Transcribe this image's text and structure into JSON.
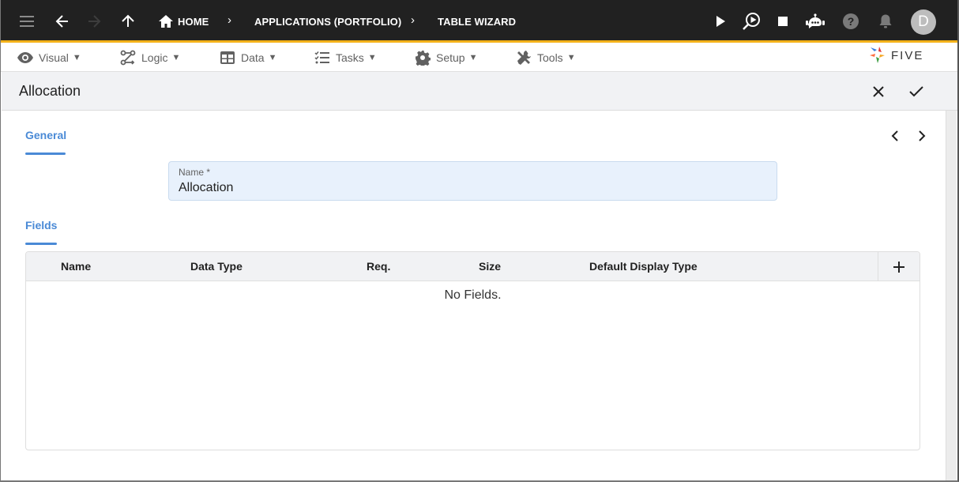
{
  "topbar": {
    "breadcrumbs": [
      "HOME",
      "APPLICATIONS (PORTFOLIO)",
      "TABLE WIZARD"
    ],
    "icons": [
      "menu-icon",
      "back-arrow-icon",
      "forward-arrow-icon",
      "up-arrow-icon",
      "home-icon",
      "play-icon",
      "debug-run-icon",
      "stop-icon",
      "chat-bot-icon",
      "help-icon",
      "notification-bell-icon"
    ],
    "avatar_initial": "D",
    "accent_color": "#f3b21a"
  },
  "menubar": {
    "items": [
      {
        "label": "Visual",
        "icon": "eye-icon"
      },
      {
        "label": "Logic",
        "icon": "logic-flow-icon"
      },
      {
        "label": "Data",
        "icon": "table-icon"
      },
      {
        "label": "Tasks",
        "icon": "checklist-icon"
      },
      {
        "label": "Setup",
        "icon": "gear-icon"
      },
      {
        "label": "Tools",
        "icon": "tools-icon"
      }
    ],
    "caret": "▼",
    "logo_text": "FIVE"
  },
  "form": {
    "title": "Allocation",
    "tabs": {
      "general": "General",
      "fields": "Fields"
    },
    "name_field": {
      "label": "Name *",
      "value": "Allocation"
    },
    "fields_table": {
      "columns": [
        "Name",
        "Data Type",
        "Req.",
        "Size",
        "Default Display Type"
      ],
      "rows": [],
      "empty_message": "No Fields."
    }
  },
  "colors": {
    "tab_active": "#4a8ad6",
    "input_bg": "#e8f1fc",
    "header_bg": "#f1f2f4"
  }
}
